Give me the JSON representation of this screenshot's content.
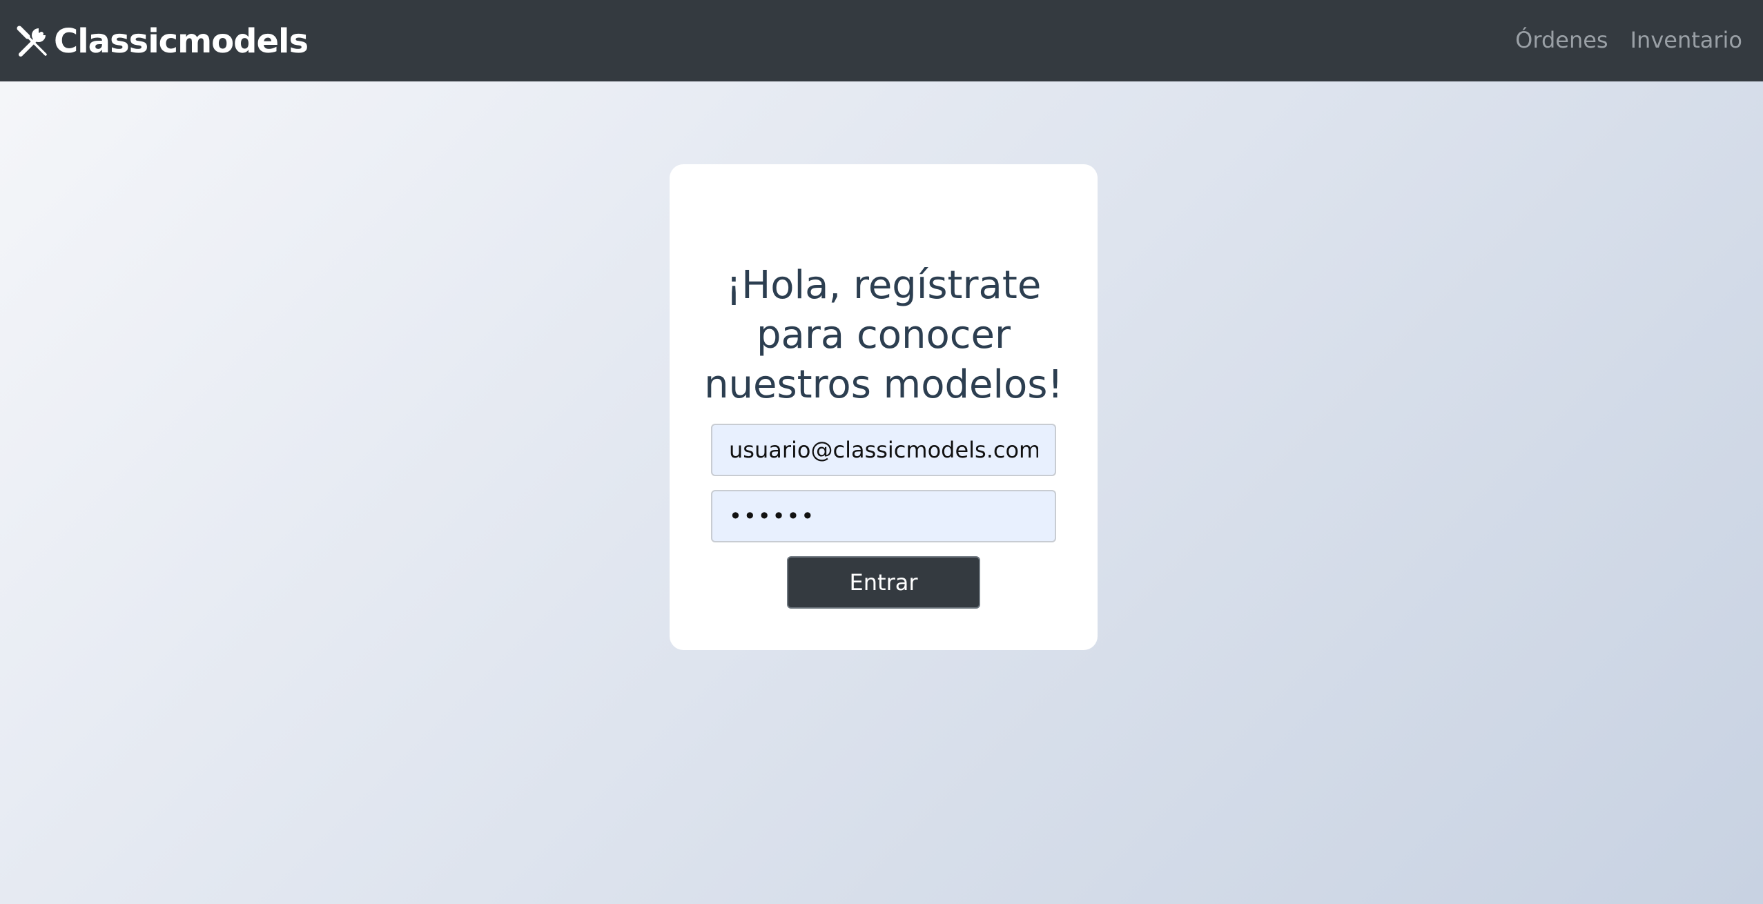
{
  "navbar": {
    "brand": {
      "icon": "tools-icon",
      "label": "Classicmodels"
    },
    "links": [
      {
        "label": "Órdenes"
      },
      {
        "label": "Inventario"
      }
    ],
    "background_color": "#343a40"
  },
  "login_card": {
    "heading": "¡Hola, regístrate para conocer nuestros modelos!",
    "email_field": {
      "value": "usuario@classicmodels.com"
    },
    "password_field": {
      "value": "••••••"
    },
    "submit_button": {
      "label": "Entrar"
    }
  },
  "colors": {
    "heading": "#2c3e50",
    "input_background": "#e8f0fe",
    "button": "#343a40"
  }
}
